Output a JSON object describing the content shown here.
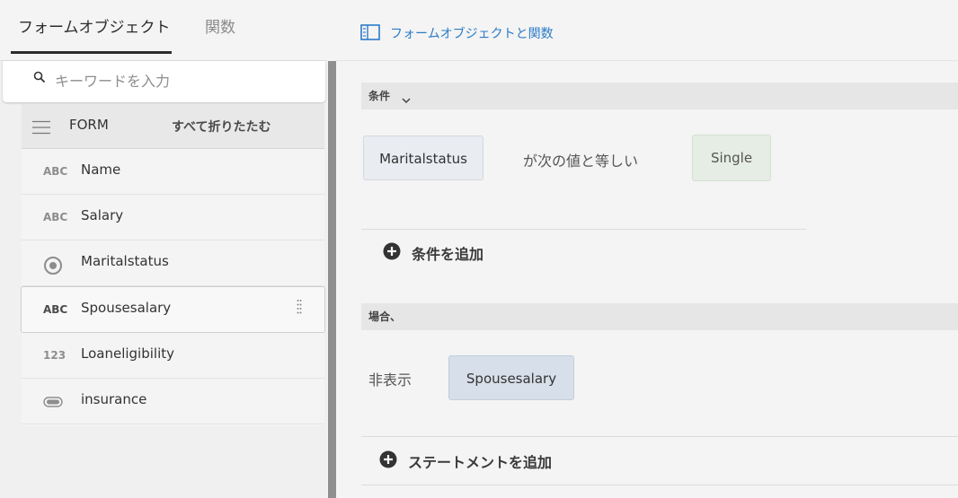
{
  "tabs": {
    "form_objects": "フォームオブジェクト",
    "functions": "関数"
  },
  "search": {
    "placeholder": "キーワードを入力"
  },
  "tree": {
    "root_label": "FORM",
    "collapse_all": "すべて折りたたむ",
    "items": [
      {
        "icon_text": "ABC",
        "label": "Name"
      },
      {
        "icon_text": "ABC",
        "label": "Salary"
      },
      {
        "icon_text": "",
        "label": "Maritalstatus"
      },
      {
        "icon_text": "ABC",
        "label": "Spousesalary"
      },
      {
        "icon_text": "123",
        "label": "Loaneligibility"
      },
      {
        "icon_text": "",
        "label": "insurance"
      }
    ]
  },
  "toolbar": {
    "toggle_link": "フォームオブジェクトと関数"
  },
  "condition": {
    "section_label": "条件",
    "field": "Maritalstatus",
    "operator": "が次の値と等しい",
    "value": "Single",
    "add_label": "条件を追加"
  },
  "then": {
    "section_label": "場合、",
    "action": "非表示",
    "target": "Spousesalary",
    "add_label": "ステートメントを追加"
  },
  "colors": {
    "accent": "#2b7bc8",
    "splitter": "#8f8f8f"
  }
}
